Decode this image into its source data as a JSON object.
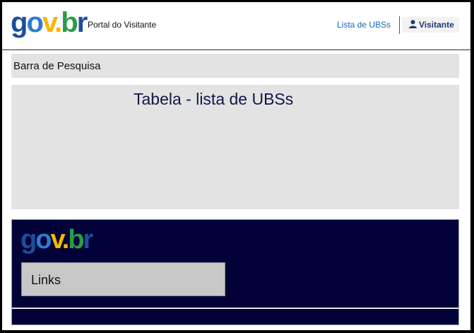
{
  "header": {
    "logo": {
      "g": "g",
      "o": "o",
      "v": "v",
      "dot": ".",
      "b": "b",
      "r": "r"
    },
    "portal_title": "Portal do Visitante",
    "nav_link": "Lista de UBSs",
    "user_label": "Visitante",
    "user_icon": "user-icon"
  },
  "search": {
    "label": "Barra de Pesquisa"
  },
  "table": {
    "label": "Tabela - lista de UBSs"
  },
  "footer": {
    "logo": {
      "g": "g",
      "o": "o",
      "v": "v",
      "dot": ".",
      "b": "b",
      "r": "r"
    },
    "links_label": "Links"
  },
  "colors": {
    "footer_bg": "#020238",
    "link": "#1565c0",
    "panel_bg": "#e3e3e3"
  }
}
